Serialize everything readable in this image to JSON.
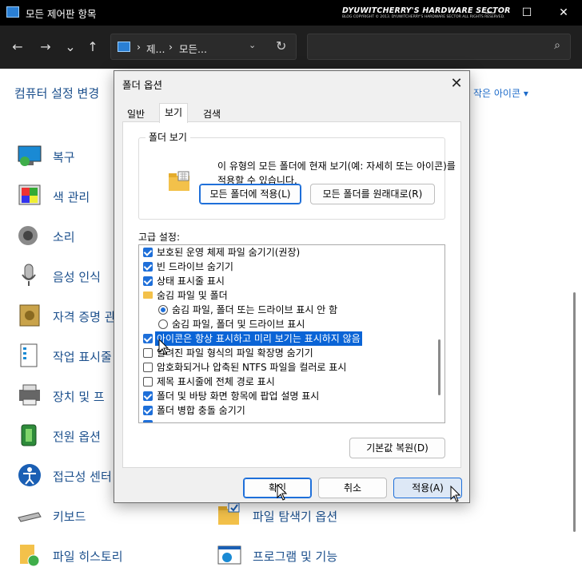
{
  "window": {
    "title": "모든 제어판 항목",
    "brand_main": "DYUWITCHERRY'S HARDWARE SECTOR",
    "brand_sub": "BLOG COPYRIGHT © 2013. DYUWITCHERRY'S HARDWARE SECTOR ALL RIGHTS RESERVED.",
    "min_glyph": "—",
    "max_glyph": "☐",
    "close_glyph": "✕"
  },
  "address": {
    "back_glyph": "←",
    "forward_glyph": "→",
    "recent_glyph": "⌄",
    "up_glyph": "↑",
    "sep_glyph": "›",
    "crumb1": "제...",
    "crumb2": "모든...",
    "dropdown_glyph": "⌄",
    "refresh_glyph": "↻",
    "search_glyph": "⌕"
  },
  "controlpanel": {
    "header": "컴퓨터 설정 변경",
    "view_by": "작은 아이콘 ▾",
    "items": [
      {
        "label": "복구"
      },
      {
        "label": "색 관리"
      },
      {
        "label": "소리"
      },
      {
        "label": "음성 인식"
      },
      {
        "label": "자격 증명 관"
      },
      {
        "label": "작업 표시줄"
      },
      {
        "label": "장치 및 프"
      },
      {
        "label": "전원 옵션"
      },
      {
        "label": "접근성 센터"
      },
      {
        "label": "키보드"
      },
      {
        "label": "파일 히스토리"
      },
      {
        "label": "파일 탐색기 옵션"
      },
      {
        "label": "프로그램 및 기능"
      }
    ]
  },
  "dialog": {
    "title": "폴더 옵션",
    "close_glyph": "✕",
    "tabs": [
      "일반",
      "보기",
      "검색"
    ],
    "folder_views_title": "폴더 보기",
    "folder_views_desc": "이 유형의 모든 폴더에 현재 보기(예: 자세히 또는 아이콘)를 적용할 수 있습니다.",
    "apply_folders_btn": "모든 폴더에 적용(L)",
    "reset_folders_btn": "모든 폴더를 원래대로(R)",
    "advanced_label": "고급 설정:",
    "rows": [
      {
        "text": "보호된 운영 체제 파일 숨기기(권장)"
      },
      {
        "text": "빈 드라이브 숨기기"
      },
      {
        "text": "상태 표시줄 표시"
      },
      {
        "text": "숨김 파일 및 폴더"
      },
      {
        "text": "숨김 파일, 폴더 또는 드라이브 표시 안 함"
      },
      {
        "text": "숨김 파일, 폴더 및 드라이브 표시"
      },
      {
        "text": "아이콘은 항상 표시하고 미리 보기는 표시하지 않음"
      },
      {
        "text": "알려진 파일 형식의 파일 확장명 숨기기"
      },
      {
        "text": "암호화되거나 압축된 NTFS 파일을 컬러로 표시"
      },
      {
        "text": "제목 표시줄에 전체 경로 표시"
      },
      {
        "text": "폴더 및 바탕 화면 항목에 팝업 설명 표시"
      },
      {
        "text": "폴더 병합 충돌 숨기기"
      }
    ],
    "restore_defaults_btn": "기본값 복원(D)",
    "ok_btn": "확인",
    "cancel_btn": "취소",
    "apply_btn": "적용(A)"
  },
  "colors": {
    "accent": "#1e6fd9",
    "link": "#1b4f8c",
    "titlebar": "#000000"
  }
}
